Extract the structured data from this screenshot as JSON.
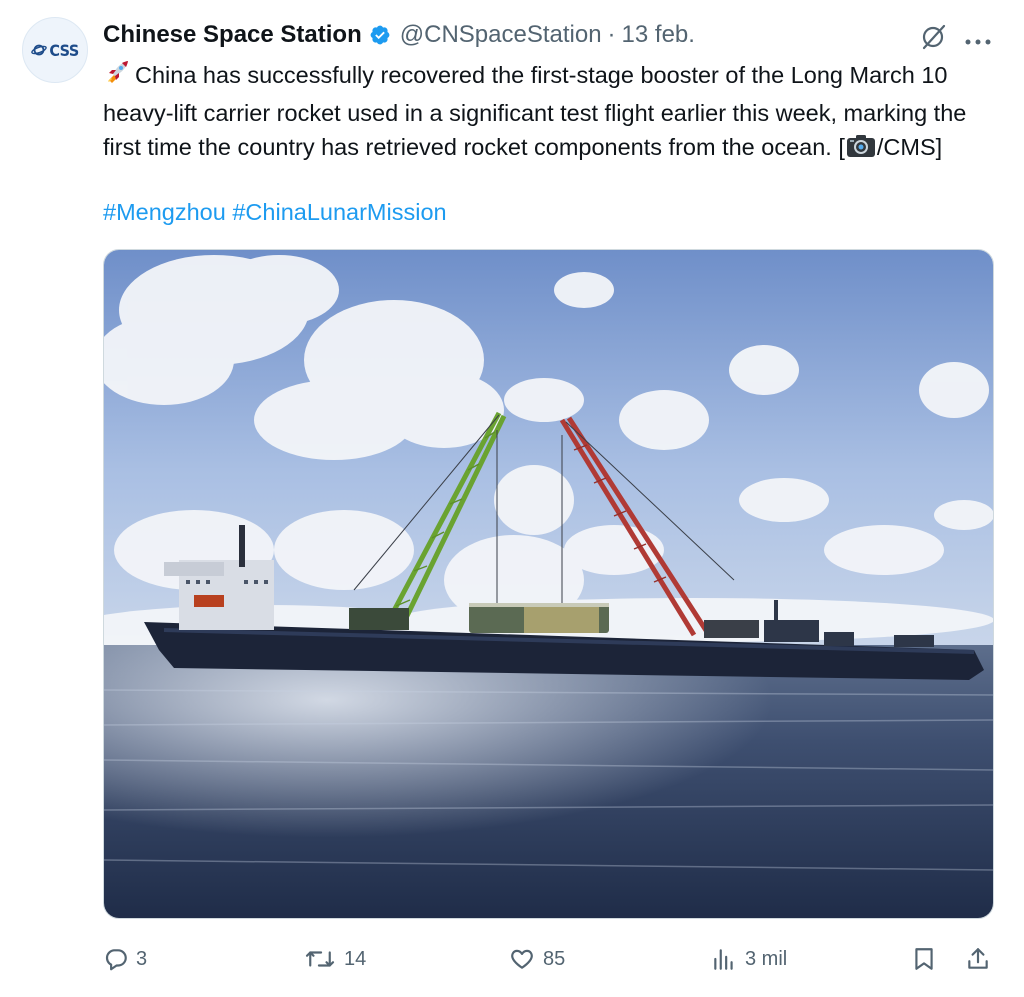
{
  "author": {
    "avatar_text": "CSS",
    "name": "Chinese Space Station",
    "handle": "@CNSpaceStation",
    "separator": "·",
    "date": "13 feb."
  },
  "tweet": {
    "text_part1": "China has successfully recovered the first-stage booster of the Long March 10 heavy-lift carrier rocket used in a significant test flight earlier this week, marking the first time the country has retrieved rocket components from the ocean. [",
    "text_part2": "/CMS]",
    "hashtags": [
      "#Mengzhou",
      "#ChinaLunarMission"
    ]
  },
  "actions": {
    "replies": "3",
    "reposts": "14",
    "likes": "85",
    "views": "3 mil"
  },
  "icons": {
    "verified": "verified-badge-icon",
    "grok": "grok-icon",
    "more": "more-icon",
    "rocket": "rocket-emoji-icon",
    "camera": "camera-emoji-icon"
  },
  "colors": {
    "text": "#0f1419",
    "secondary": "#536471",
    "link": "#1d9bf0",
    "verified": "#1d9bf0"
  }
}
